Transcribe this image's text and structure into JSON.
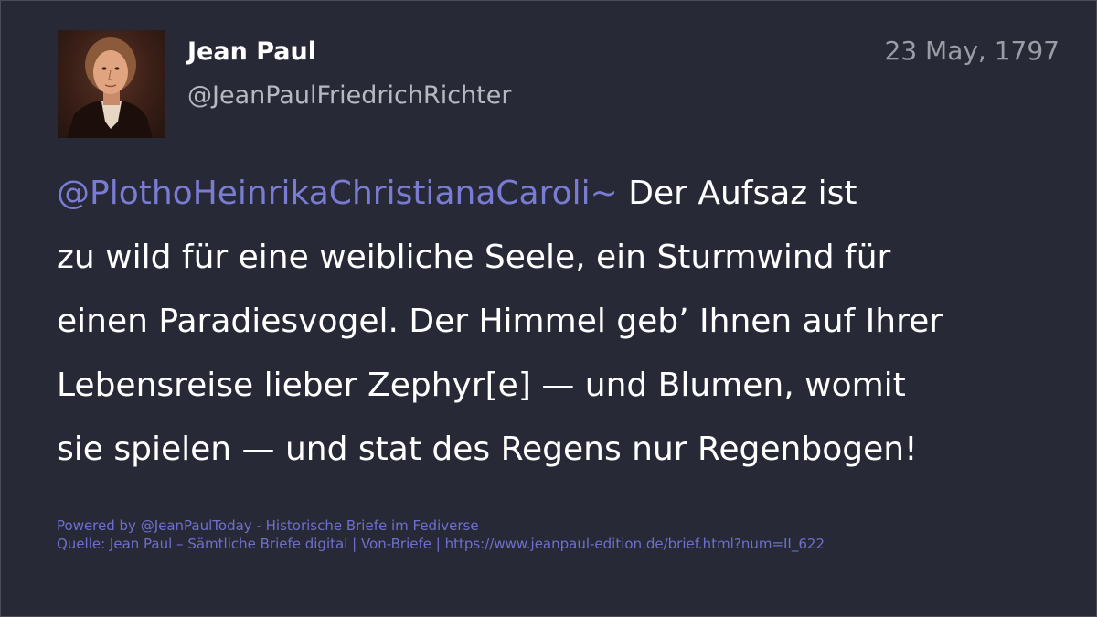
{
  "post": {
    "author_name": "Jean Paul",
    "author_handle": "@JeanPaulFriedrichRichter",
    "date": "23 May, 1797",
    "mention": "@PlothoHeinrikaChristianaCaroli~",
    "text_lines": [
      " Der Aufsaz ist",
      "zu wild für eine weibliche Seele, ein Sturmwind für",
      "einen Paradiesvogel. Der Himmel geb’ Ihnen auf Ihrer",
      "Lebensreise lieber Zephyr[e] — und Blumen, womit",
      "sie spielen — und stat des Regens nur Regenbogen!"
    ]
  },
  "footer": {
    "powered_by": "Powered by @JeanPaulToday - Historische Briefe im Fediverse",
    "source": "Quelle: Jean Paul – Sämtliche Briefe digital | Von-Briefe | https://www.jeanpaul-edition.de/brief.html?num=II_622"
  },
  "colors": {
    "background": "#272a36",
    "mention": "#7a7bd3",
    "footer_link": "#6f6fcc"
  },
  "icons": {
    "avatar": "portrait-avatar"
  }
}
